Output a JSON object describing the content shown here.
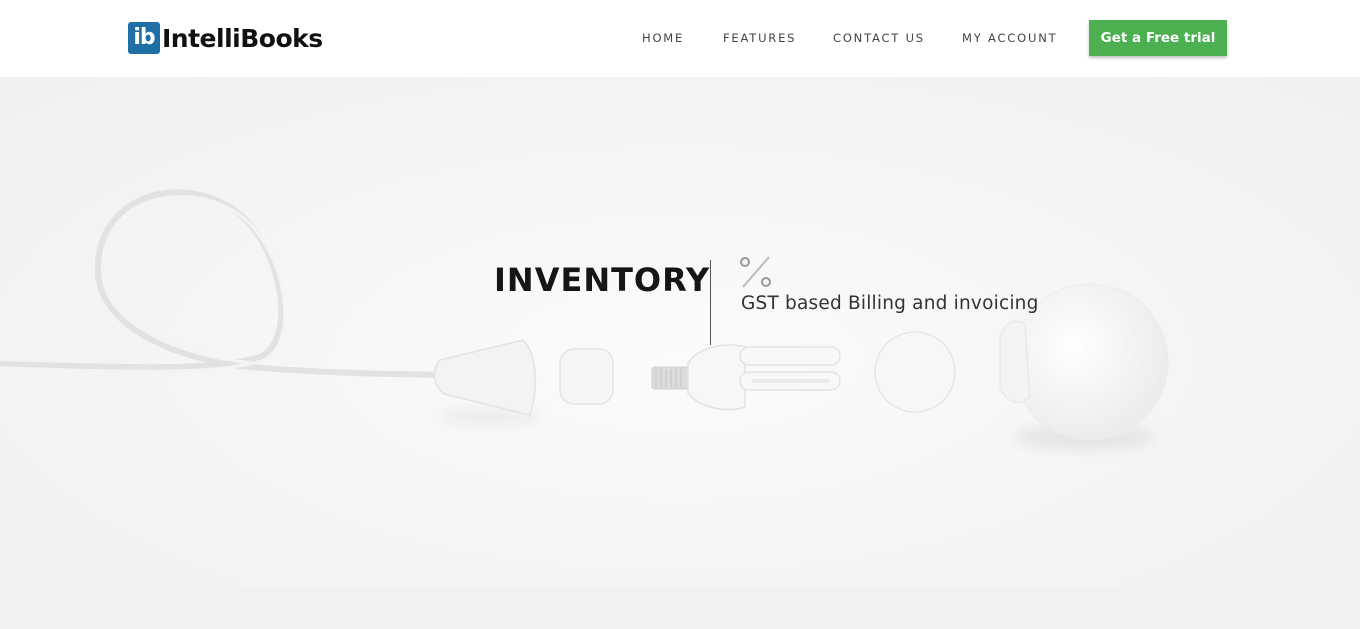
{
  "brand": {
    "mark": "ib",
    "name": "IntelliBooks",
    "color": "#1f6fa7"
  },
  "nav": {
    "items": [
      {
        "label": "HOME"
      },
      {
        "label": "FEATURES"
      },
      {
        "label": "CONTACT US"
      },
      {
        "label": "MY ACCOUNT"
      }
    ],
    "cta_label": "Get a Free trial",
    "cta_color": "#4caf50"
  },
  "hero": {
    "title": "INVENTORY",
    "icon": "percent-icon",
    "subtitle": "GST based Billing and invoicing"
  }
}
